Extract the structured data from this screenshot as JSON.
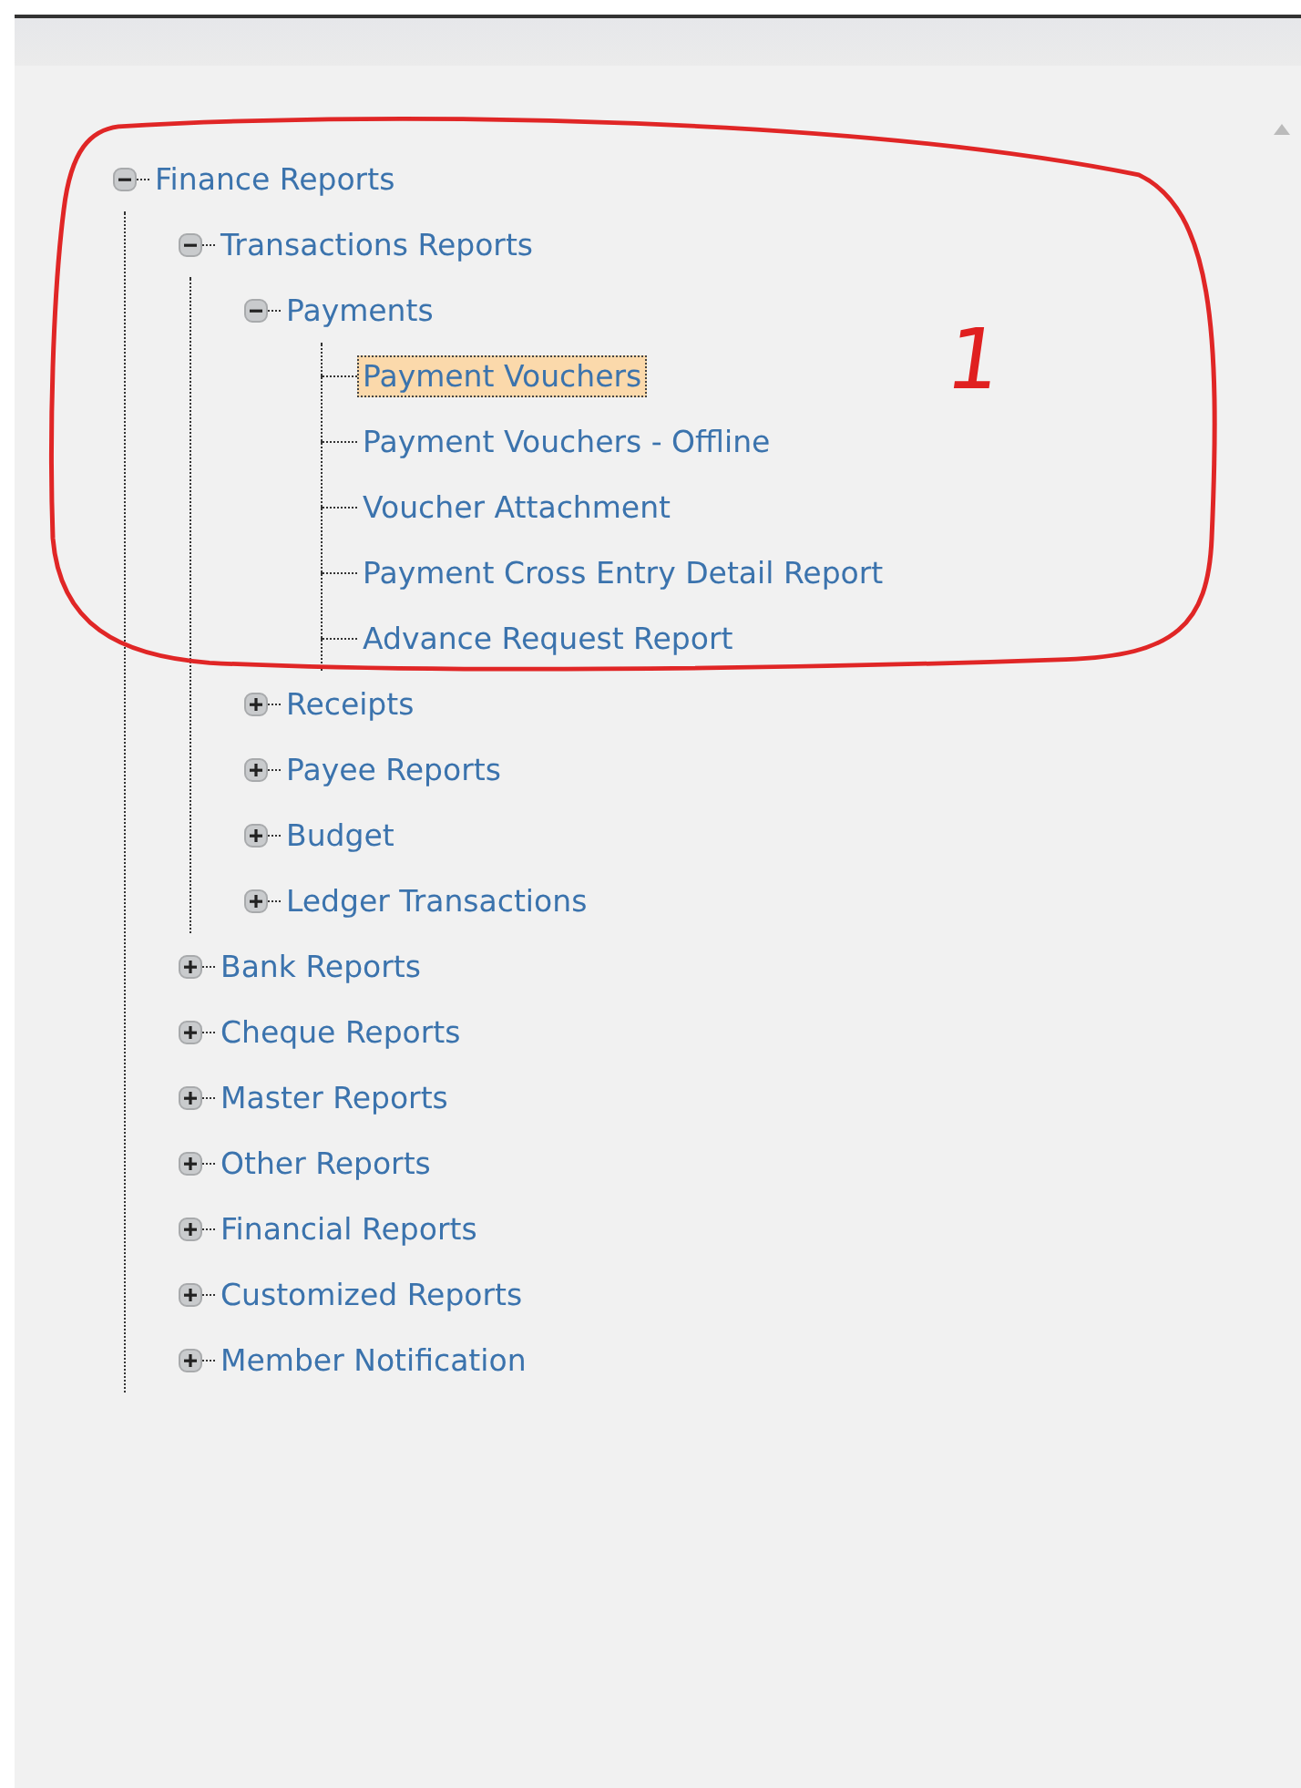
{
  "tree": [
    {
      "label": "Finance Reports",
      "expanded": true,
      "selected": false,
      "children": [
        {
          "label": "Transactions Reports",
          "expanded": true,
          "selected": false,
          "children": [
            {
              "label": "Payments",
              "expanded": true,
              "selected": false,
              "children": [
                {
                  "label": "Payment Vouchers",
                  "selected": true
                },
                {
                  "label": "Payment Vouchers - Offline",
                  "selected": false
                },
                {
                  "label": "Voucher Attachment",
                  "selected": false
                },
                {
                  "label": "Payment Cross Entry Detail Report",
                  "selected": false
                },
                {
                  "label": "Advance Request Report",
                  "selected": false
                }
              ]
            },
            {
              "label": "Receipts",
              "expanded": false,
              "selected": false
            },
            {
              "label": "Payee Reports",
              "expanded": false,
              "selected": false
            },
            {
              "label": "Budget",
              "expanded": false,
              "selected": false
            },
            {
              "label": "Ledger Transactions",
              "expanded": false,
              "selected": false
            }
          ]
        },
        {
          "label": "Bank Reports",
          "expanded": false,
          "selected": false
        },
        {
          "label": "Cheque Reports",
          "expanded": false,
          "selected": false
        },
        {
          "label": "Master Reports",
          "expanded": false,
          "selected": false
        },
        {
          "label": "Other Reports",
          "expanded": false,
          "selected": false
        },
        {
          "label": "Financial Reports",
          "expanded": false,
          "selected": false
        },
        {
          "label": "Customized Reports",
          "expanded": false,
          "selected": false
        },
        {
          "label": "Member Notification",
          "expanded": false,
          "selected": false
        }
      ]
    }
  ],
  "annotation": {
    "label": "1"
  }
}
